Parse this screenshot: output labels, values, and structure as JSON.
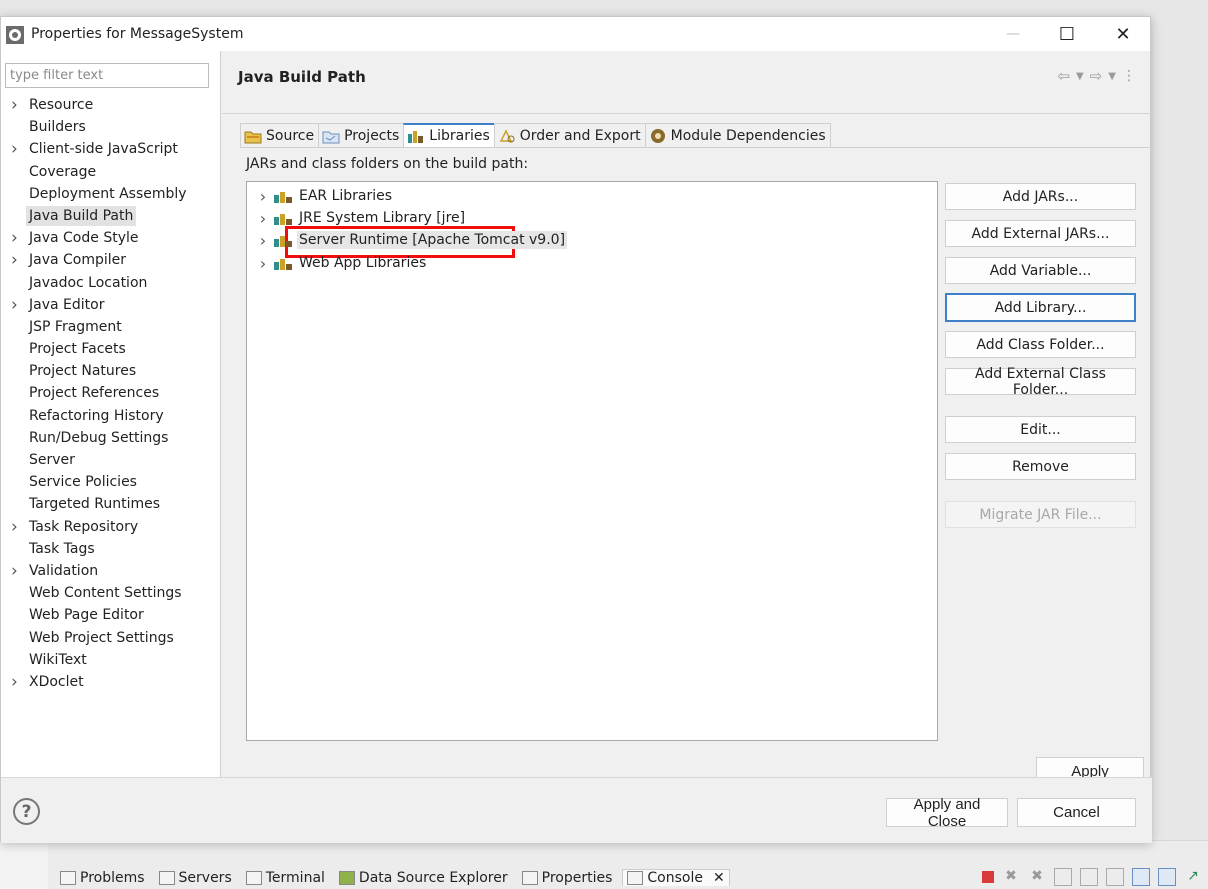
{
  "window": {
    "title": "Properties for MessageSystem",
    "minimize_glyph": "—",
    "maximize_glyph": "☐",
    "close_glyph": "✕"
  },
  "filter": {
    "placeholder": "type filter text",
    "value": ""
  },
  "nav": {
    "items": [
      {
        "label": "Resource",
        "expandable": true
      },
      {
        "label": "Builders",
        "expandable": false
      },
      {
        "label": "Client-side JavaScript",
        "expandable": true
      },
      {
        "label": "Coverage",
        "expandable": false
      },
      {
        "label": "Deployment Assembly",
        "expandable": false
      },
      {
        "label": "Java Build Path",
        "expandable": false,
        "selected": true
      },
      {
        "label": "Java Code Style",
        "expandable": true
      },
      {
        "label": "Java Compiler",
        "expandable": true
      },
      {
        "label": "Javadoc Location",
        "expandable": false
      },
      {
        "label": "Java Editor",
        "expandable": true
      },
      {
        "label": "JSP Fragment",
        "expandable": false
      },
      {
        "label": "Project Facets",
        "expandable": false
      },
      {
        "label": "Project Natures",
        "expandable": false
      },
      {
        "label": "Project References",
        "expandable": false
      },
      {
        "label": "Refactoring History",
        "expandable": false
      },
      {
        "label": "Run/Debug Settings",
        "expandable": false
      },
      {
        "label": "Server",
        "expandable": false
      },
      {
        "label": "Service Policies",
        "expandable": false
      },
      {
        "label": "Targeted Runtimes",
        "expandable": false
      },
      {
        "label": "Task Repository",
        "expandable": true
      },
      {
        "label": "Task Tags",
        "expandable": false
      },
      {
        "label": "Validation",
        "expandable": true
      },
      {
        "label": "Web Content Settings",
        "expandable": false
      },
      {
        "label": "Web Page Editor",
        "expandable": false
      },
      {
        "label": "Web Project Settings",
        "expandable": false
      },
      {
        "label": "WikiText",
        "expandable": false
      },
      {
        "label": "XDoclet",
        "expandable": true
      }
    ]
  },
  "page": {
    "title": "Java Build Path",
    "tabs": [
      {
        "label": "Source",
        "icon": "source-folder-icon"
      },
      {
        "label": "Projects",
        "icon": "projects-icon"
      },
      {
        "label": "Libraries",
        "icon": "libraries-icon",
        "active": true
      },
      {
        "label": "Order and Export",
        "icon": "order-export-icon"
      },
      {
        "label": "Module Dependencies",
        "icon": "module-icon"
      }
    ],
    "jars_label": "JARs and class folders on the build path:",
    "tree": [
      {
        "label": "EAR Libraries",
        "expandable": true
      },
      {
        "label": "JRE System Library [jre]",
        "expandable": true,
        "marked": true
      },
      {
        "label": "Server Runtime [Apache Tomcat v9.0]",
        "expandable": true,
        "highlighted": true
      },
      {
        "label": "Web App Libraries",
        "expandable": true
      }
    ],
    "buttons": {
      "add_jars": "Add JARs...",
      "add_external_jars": "Add External JARs...",
      "add_variable": "Add Variable...",
      "add_library": "Add Library...",
      "add_class_folder": "Add Class Folder...",
      "add_external_class_folder": "Add External Class Folder...",
      "edit": "Edit...",
      "remove": "Remove",
      "migrate_jar": "Migrate JAR File..."
    },
    "apply": "Apply"
  },
  "footer": {
    "help": "?",
    "apply_and_close": "Apply and Close",
    "cancel": "Cancel"
  },
  "taskbar": {
    "views": [
      {
        "label": "Problems"
      },
      {
        "label": "Servers"
      },
      {
        "label": "Terminal"
      },
      {
        "label": "Data Source Explorer"
      },
      {
        "label": "Properties"
      },
      {
        "label": "Console",
        "active": true
      }
    ],
    "close_glyph": "✕"
  },
  "colors": {
    "accent": "#3d7fc8",
    "annotation_red": "#f20d0d",
    "library_icon_gold": "#c9a227",
    "library_icon_teal": "#2f8f8a"
  }
}
